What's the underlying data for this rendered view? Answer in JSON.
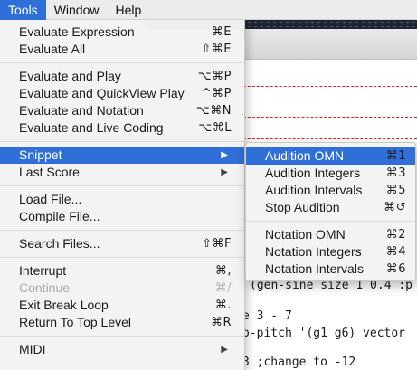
{
  "menubar": {
    "items": [
      {
        "label": "Tools"
      },
      {
        "label": "Window"
      },
      {
        "label": "Help"
      }
    ]
  },
  "tools_menu": {
    "group1": [
      {
        "label": "Evaluate Expression",
        "shortcut": "⌘E"
      },
      {
        "label": "Evaluate All",
        "shortcut": "⇧⌘E"
      }
    ],
    "group2": [
      {
        "label": "Evaluate and Play",
        "shortcut": "⌥⌘P"
      },
      {
        "label": "Evaluate and QuickView Play",
        "shortcut": "^⌘P"
      },
      {
        "label": "Evaluate and Notation",
        "shortcut": "⌥⌘N"
      },
      {
        "label": "Evaluate and Live Coding",
        "shortcut": "⌥⌘L"
      }
    ],
    "group3": [
      {
        "label": "Snippet"
      },
      {
        "label": "Last Score"
      }
    ],
    "group4": [
      {
        "label": "Load File..."
      },
      {
        "label": "Compile File..."
      }
    ],
    "group5": [
      {
        "label": "Search Files...",
        "shortcut": "⇧⌘F"
      }
    ],
    "group6": [
      {
        "label": "Interrupt",
        "shortcut": "⌘,"
      },
      {
        "label": "Continue",
        "shortcut": "⌘/"
      },
      {
        "label": "Exit Break Loop",
        "shortcut": "⌘."
      },
      {
        "label": "Return To Top Level",
        "shortcut": "⌘R"
      }
    ],
    "group7": [
      {
        "label": "MIDI"
      }
    ]
  },
  "snippet_submenu": {
    "group1": [
      {
        "label": "Audition OMN",
        "shortcut": "⌘1"
      },
      {
        "label": "Audition Integers",
        "shortcut": "⌘3"
      },
      {
        "label": "Audition Intervals",
        "shortcut": "⌘5"
      },
      {
        "label": "Stop Audition",
        "shortcut": "⌘↺"
      }
    ],
    "group2": [
      {
        "label": "Notation OMN",
        "shortcut": "⌘2"
      },
      {
        "label": "Notation Integers",
        "shortcut": "⌘4"
      },
      {
        "label": "Notation Intervals",
        "shortcut": "⌘6"
      }
    ]
  },
  "editor": {
    "line1": "(gen-sine size 1 0.4 :p",
    "line2": "e 3 - 7",
    "line3": "o-pitch '(g1 g6) vector",
    "line4": "3 ;change to -12"
  },
  "colors": {
    "highlight": "#2f6fd7",
    "menu_bg": "#f3f3f3",
    "rule_red": "#e01b1b"
  }
}
